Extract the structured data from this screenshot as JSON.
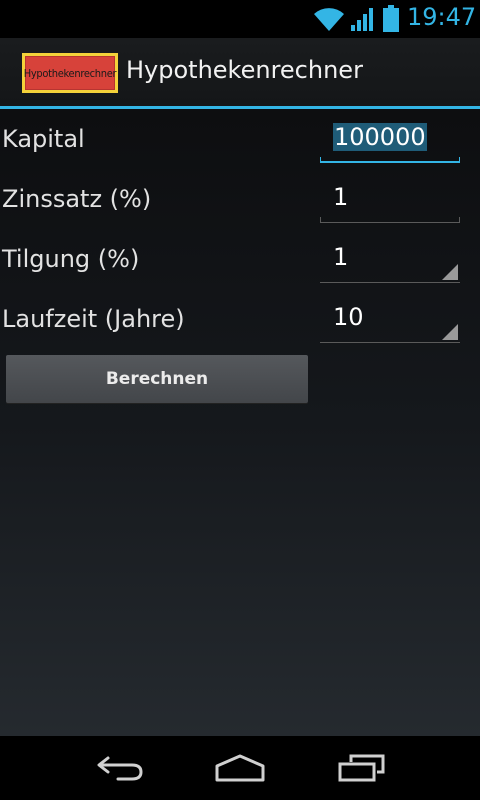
{
  "status_bar": {
    "time": "19:47",
    "icons": [
      "wifi-icon",
      "signal-icon",
      "battery-icon"
    ],
    "accent_color": "#33b5e5"
  },
  "action_bar": {
    "logo_text": "Hypothekenrechner",
    "title": "Hypothekenrechner"
  },
  "form": {
    "kapital": {
      "label": "Kapital",
      "value": "100000"
    },
    "zinssatz": {
      "label": "Zinssatz (%)",
      "value": "1"
    },
    "tilgung": {
      "label": "Tilgung (%)",
      "value": "1"
    },
    "laufzeit": {
      "label": "Laufzeit (Jahre)",
      "value": "10"
    }
  },
  "button": {
    "label": "Berechnen"
  },
  "nav_bar": {
    "icons": [
      "back-icon",
      "home-icon",
      "recent-apps-icon"
    ]
  }
}
